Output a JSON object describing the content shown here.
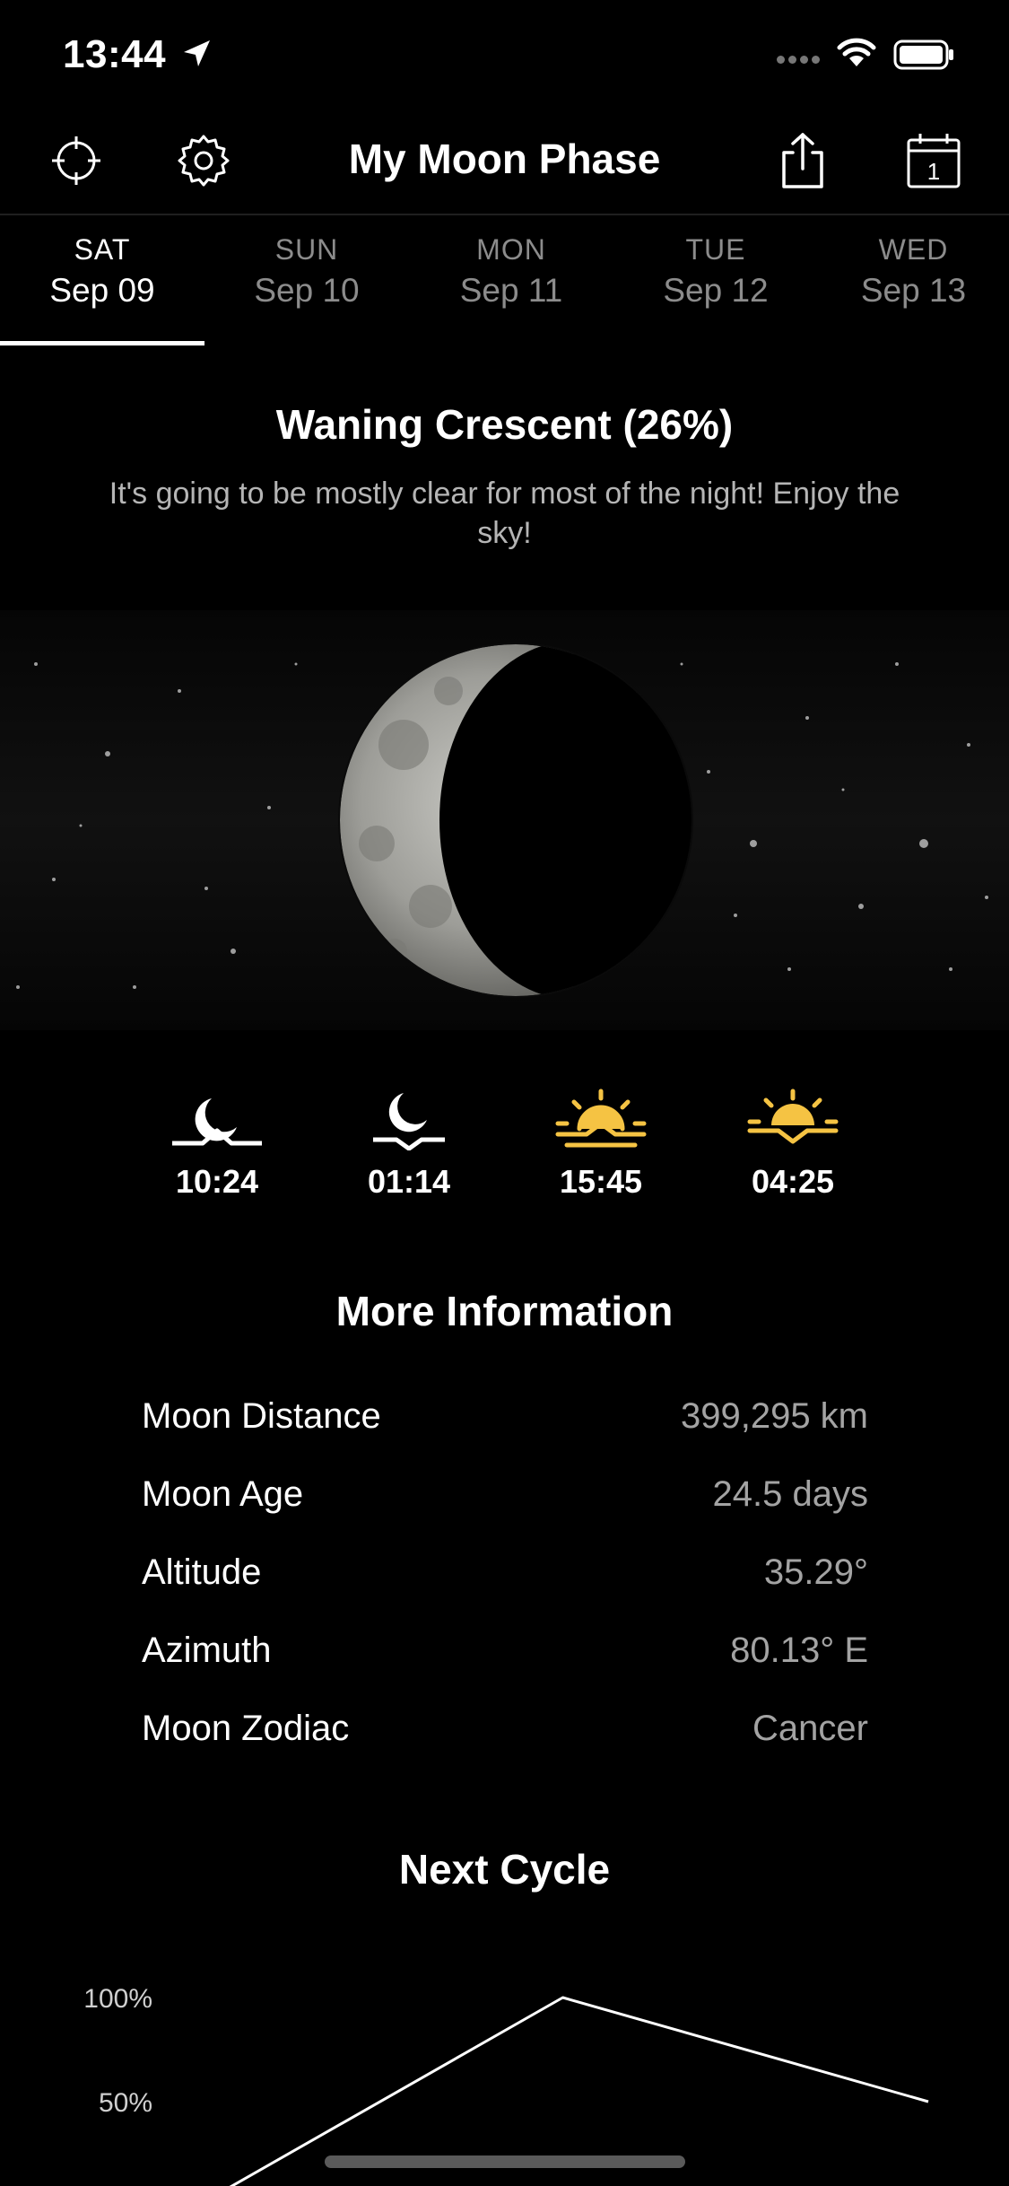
{
  "status_bar": {
    "time": "13:44"
  },
  "header": {
    "title": "My Moon Phase"
  },
  "tabs": [
    {
      "dow": "SAT",
      "date": "Sep 09",
      "active": true
    },
    {
      "dow": "SUN",
      "date": "Sep 10",
      "active": false
    },
    {
      "dow": "MON",
      "date": "Sep 11",
      "active": false
    },
    {
      "dow": "TUE",
      "date": "Sep 12",
      "active": false
    },
    {
      "dow": "WED",
      "date": "Sep 13",
      "active": false
    }
  ],
  "phase": {
    "title": "Waning Crescent (26%)",
    "description": "It's going to be mostly clear for most of the night! Enjoy the sky!"
  },
  "rise_set": [
    {
      "icon": "moonrise-icon",
      "time": "10:24"
    },
    {
      "icon": "moonset-icon",
      "time": "01:14"
    },
    {
      "icon": "sunrise-icon",
      "time": "15:45"
    },
    {
      "icon": "sunset-icon",
      "time": "04:25"
    }
  ],
  "more_info": {
    "title": "More Information",
    "rows": [
      {
        "label": "Moon Distance",
        "value": "399,295 km"
      },
      {
        "label": "Moon Age",
        "value": "24.5 days"
      },
      {
        "label": "Altitude",
        "value": "35.29°"
      },
      {
        "label": "Azimuth",
        "value": "80.13° E"
      },
      {
        "label": "Moon Zodiac",
        "value": "Cancer"
      }
    ]
  },
  "next_cycle": {
    "title": "Next Cycle",
    "y_ticks": [
      "100%",
      "50%"
    ]
  },
  "chart_data": {
    "type": "line",
    "x": [
      0,
      1,
      2
    ],
    "values": [
      0,
      100,
      50
    ],
    "ylim": [
      0,
      100
    ],
    "grid": false
  },
  "colors": {
    "accent_sun": "#F5C343",
    "moon_icon": "#FFFFFF"
  }
}
